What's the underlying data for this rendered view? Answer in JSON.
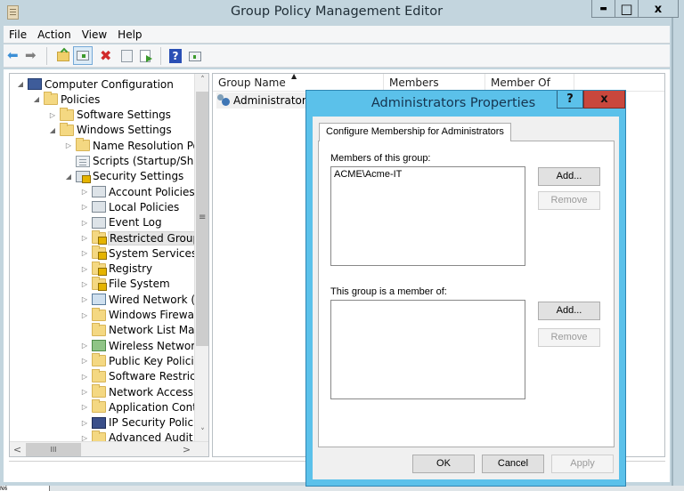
{
  "window": {
    "title": "Group Policy Management Editor",
    "controls": {
      "minimize": "▬",
      "maximize": "□",
      "close": "x"
    }
  },
  "menubar": {
    "items": [
      {
        "label": "File"
      },
      {
        "label": "Action"
      },
      {
        "label": "View"
      },
      {
        "label": "Help"
      }
    ]
  },
  "toolbar": {
    "buttons": [
      {
        "name": "back",
        "icon": "back-arrow-icon",
        "glyph": "⬅",
        "color": "#3b8fd6"
      },
      {
        "name": "forward",
        "icon": "forward-arrow-icon",
        "glyph": "➡",
        "color": "#7f7f7f"
      },
      {
        "name": "up-one-level",
        "icon": "folder-up-icon"
      },
      {
        "name": "show-hide-console-tree",
        "icon": "console-tree-icon",
        "active": true
      },
      {
        "name": "delete",
        "icon": "delete-icon",
        "glyph": "✖",
        "color": "#d12a2a"
      },
      {
        "name": "properties",
        "icon": "properties-icon"
      },
      {
        "name": "export-list",
        "icon": "export-list-icon"
      },
      {
        "name": "help",
        "icon": "help-icon",
        "glyph": "?",
        "color": "#2a4fb5"
      },
      {
        "name": "show-action-pane",
        "icon": "action-pane-icon"
      }
    ]
  },
  "tree": {
    "nodes": [
      {
        "label": "Computer Configuration",
        "level": 0,
        "expander": "◢",
        "icon": "computer-icon"
      },
      {
        "label": "Policies",
        "level": 1,
        "expander": "◢",
        "icon": "folder-icon"
      },
      {
        "label": "Software Settings",
        "level": 2,
        "expander": "▷",
        "icon": "folder-icon"
      },
      {
        "label": "Windows Settings",
        "level": 2,
        "expander": "◢",
        "icon": "folder-icon"
      },
      {
        "label": "Name Resolution Pol",
        "level": 3,
        "expander": "▷",
        "icon": "folder-icon"
      },
      {
        "label": "Scripts (Startup/Shutc",
        "level": 3,
        "expander": "",
        "icon": "script-icon"
      },
      {
        "label": "Security Settings",
        "level": 3,
        "expander": "◢",
        "icon": "security-settings-icon"
      },
      {
        "label": "Account Policies",
        "level": 4,
        "expander": "▷",
        "icon": "policy-icon"
      },
      {
        "label": "Local Policies",
        "level": 4,
        "expander": "▷",
        "icon": "policy-icon"
      },
      {
        "label": "Event Log",
        "level": 4,
        "expander": "▷",
        "icon": "policy-icon"
      },
      {
        "label": "Restricted Groups",
        "level": 4,
        "expander": "▷",
        "icon": "locked-folder-icon",
        "selected": true
      },
      {
        "label": "System Services",
        "level": 4,
        "expander": "▷",
        "icon": "locked-folder-icon"
      },
      {
        "label": "Registry",
        "level": 4,
        "expander": "▷",
        "icon": "locked-folder-icon"
      },
      {
        "label": "File System",
        "level": 4,
        "expander": "▷",
        "icon": "locked-folder-icon"
      },
      {
        "label": "Wired Network (IE",
        "level": 4,
        "expander": "▷",
        "icon": "wired-network-icon"
      },
      {
        "label": "Windows Firewall",
        "level": 4,
        "expander": "▷",
        "icon": "folder-icon"
      },
      {
        "label": "Network List Man",
        "level": 4,
        "expander": "",
        "icon": "folder-icon"
      },
      {
        "label": "Wireless Network",
        "level": 4,
        "expander": "▷",
        "icon": "wireless-network-icon"
      },
      {
        "label": "Public Key Policie",
        "level": 4,
        "expander": "▷",
        "icon": "folder-icon"
      },
      {
        "label": "Software Restricti",
        "level": 4,
        "expander": "▷",
        "icon": "folder-icon"
      },
      {
        "label": "Network Access P",
        "level": 4,
        "expander": "▷",
        "icon": "folder-icon"
      },
      {
        "label": "Application Contr",
        "level": 4,
        "expander": "▷",
        "icon": "folder-icon"
      },
      {
        "label": "IP Security Policie",
        "level": 4,
        "expander": "▷",
        "icon": "ip-security-icon"
      },
      {
        "label": "Advanced Audit P",
        "level": 4,
        "expander": "▷",
        "icon": "folder-icon"
      }
    ],
    "scroll": {
      "up": "˄",
      "down": "˅",
      "left": "<",
      "right": ">",
      "grip_v": "≡",
      "grip_h": "III"
    }
  },
  "list": {
    "columns": [
      {
        "label": "Group Name",
        "sort": "▲"
      },
      {
        "label": "Members"
      },
      {
        "label": "Member Of"
      }
    ],
    "rows": [
      {
        "name": "Administrators",
        "members": "",
        "member_of": ""
      }
    ]
  },
  "dialog": {
    "title": "Administrators Properties",
    "help": "?",
    "close": "x",
    "tab": "Configure Membership for Administrators",
    "members_label": "Members of this group:",
    "members": [
      "ACME\\Acme-IT"
    ],
    "memberof_label": "This group is a member of:",
    "memberof": [],
    "add_label": "Add...",
    "remove_label": "Remove",
    "ok_label": "OK",
    "cancel_label": "Cancel",
    "apply_label": "Apply",
    "colors": {
      "frame": "#5bc1ea",
      "close": "#c9473d"
    }
  },
  "taskbar": {
    "label": "N6"
  }
}
